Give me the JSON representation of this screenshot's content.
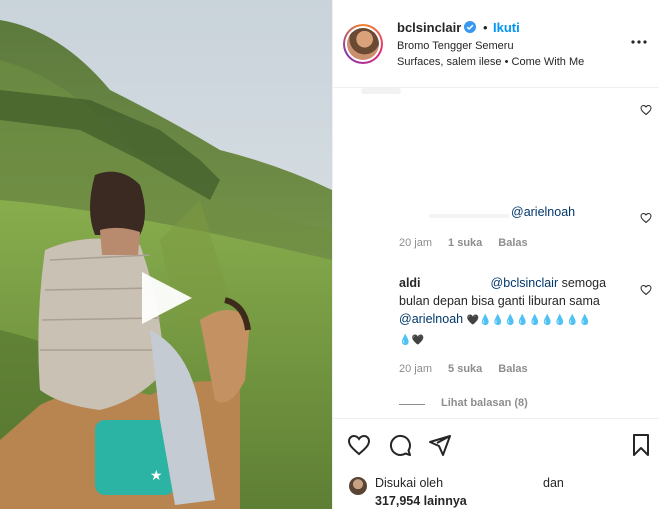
{
  "post": {
    "username": "bclsinclair",
    "dot": "•",
    "follow_label": "Ikuti",
    "location": "Bromo Tengger Semeru",
    "audio": "Surfaces, salem ilese • Come With Me"
  },
  "comments": {
    "c2": {
      "mention": "@arielnoah",
      "time": "20 jam",
      "likes": "1 suka",
      "reply": "Balas"
    },
    "c3": {
      "user": "aldi",
      "mention1": "@bclsinclair",
      "text1": "semoga",
      "text2": "bulan depan bisa ganti liburan sama",
      "mention2": "@arielnoah",
      "emojis1": "🖤💧💧💧💧💧💧💧💧💧",
      "emojis2": "💧🖤",
      "time": "20 jam",
      "likes": "5 suka",
      "reply": "Balas",
      "view_replies": "Lihat balasan (8)"
    }
  },
  "footer": {
    "liked_by": "Disukai oleh",
    "and": "dan",
    "count": "317,954 lainnya"
  },
  "colors": {
    "link": "#0095f6",
    "mention": "#00376b",
    "meta": "#8e8e8e"
  }
}
